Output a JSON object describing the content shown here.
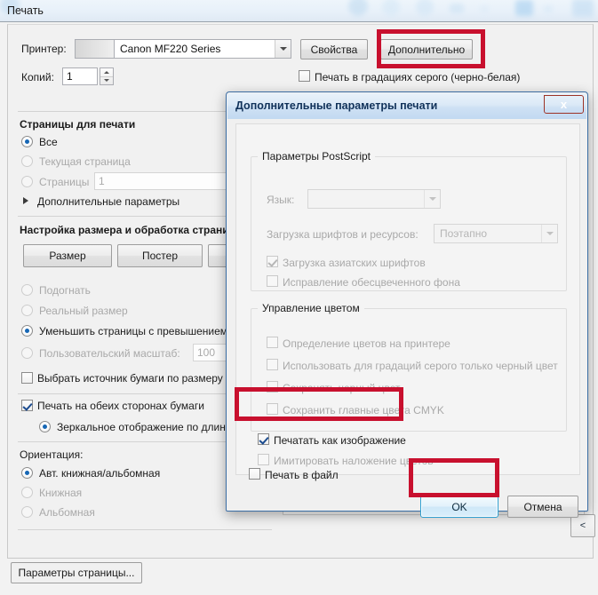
{
  "window": {
    "title": "Печать"
  },
  "printer": {
    "label": "Принтер:",
    "value": "Canon MF220 Series",
    "properties_button": "Свойства",
    "advanced_button": "Дополнительно",
    "copies_label": "Копий:",
    "copies_value": "1",
    "grayscale_checkbox": "Печать в градациях серого (черно-белая)"
  },
  "pages_group": {
    "title": "Страницы для печати",
    "all": "Все",
    "current": "Текущая страница",
    "pages": "Страницы",
    "pages_value": "1",
    "more_options": "Дополнительные параметры"
  },
  "sizing_group": {
    "title": "Настройка размера и обработка страниц",
    "size_button": "Размер",
    "poster_button": "Постер",
    "fit": "Подогнать",
    "actual_size": "Реальный размер",
    "shrink_oversized": "Уменьшить страницы с превышением",
    "custom_scale": "Пользовательский масштаб:",
    "custom_scale_value": "100",
    "paper_source": "Выбрать источник бумаги по размеру",
    "duplex": "Печать на обеих сторонах бумаги",
    "flip_long_edge": "Зеркальное отображение по длинному краю"
  },
  "orientation_group": {
    "title": "Ориентация:",
    "auto": "Авт. книжная/альбомная",
    "portrait": "Книжная",
    "landscape": "Альбомная"
  },
  "footer": {
    "page_setup_button": "Параметры страницы...",
    "collapse_button": "<"
  },
  "advanced_dialog": {
    "title": "Дополнительные параметры печати",
    "close_button": "x",
    "postscript_group": {
      "legend": "Параметры PostScript",
      "language_label": "Язык:",
      "language_value": "",
      "font_download_label": "Загрузка шрифтов и ресурсов:",
      "font_download_value": "Поэтапно",
      "asian_fonts": "Загрузка азиатских шрифтов",
      "discolored_bg": "Исправление обесцвеченного фона"
    },
    "color_group": {
      "legend": "Управление цветом",
      "printer_color": "Определение цветов на принтере",
      "gray_black_only": "Использовать для градаций серого только черный цвет",
      "preserve_black": "Сохранять черный цвет",
      "preserve_cmyk": "Сохранить главные цвета CMYK"
    },
    "print_as_image": "Печатать как изображение",
    "simulate_overprint": "Имитировать наложение цветов",
    "print_to_file": "Печать в файл",
    "ok_button": "OK",
    "cancel_button": "Отмена"
  },
  "colors": {
    "annotation_red": "#c8102e",
    "title_blue": "#11325a",
    "accent_blue": "#1767b5",
    "close_red": "#c0392b"
  }
}
